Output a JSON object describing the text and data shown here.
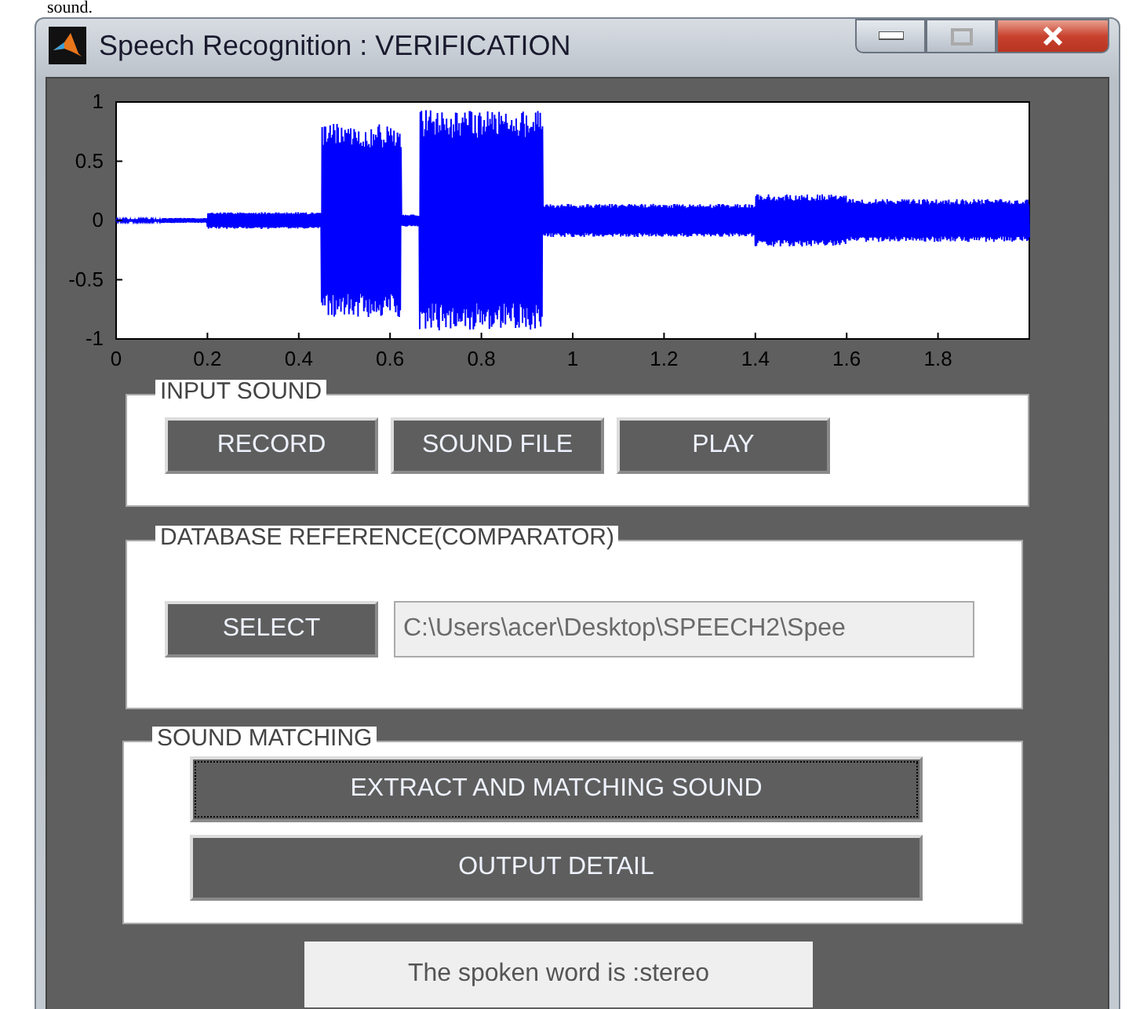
{
  "page_text": "sound.",
  "window": {
    "title": "Speech Recognition : VERIFICATION"
  },
  "plot": {
    "yticks": [
      "1",
      "0.5",
      "0",
      "-0.5",
      "-1"
    ],
    "xticks": [
      "0",
      "0.2",
      "0.4",
      "0.6",
      "0.8",
      "1",
      "1.2",
      "1.4",
      "1.6",
      "1.8"
    ]
  },
  "panels": [
    {
      "title": "INPUT SOUND",
      "kind": "buttons",
      "buttons": [
        {
          "label": "RECORD",
          "focused": false
        },
        {
          "label": "SOUND FILE",
          "focused": false
        },
        {
          "label": "PLAY",
          "focused": false
        }
      ]
    },
    {
      "title": "DATABASE REFERENCE(COMPARATOR)",
      "kind": "select",
      "buttons": [
        {
          "label": "SELECT",
          "focused": false
        }
      ],
      "path": "C:\\Users\\acer\\Desktop\\SPEECH2\\Spee"
    },
    {
      "title": "SOUND MATCHING",
      "kind": "stack",
      "buttons": [
        {
          "label": "EXTRACT AND MATCHING SOUND",
          "focused": true
        },
        {
          "label": "OUTPUT DETAIL",
          "focused": false
        }
      ]
    }
  ],
  "result": "The spoken word is :stereo"
}
